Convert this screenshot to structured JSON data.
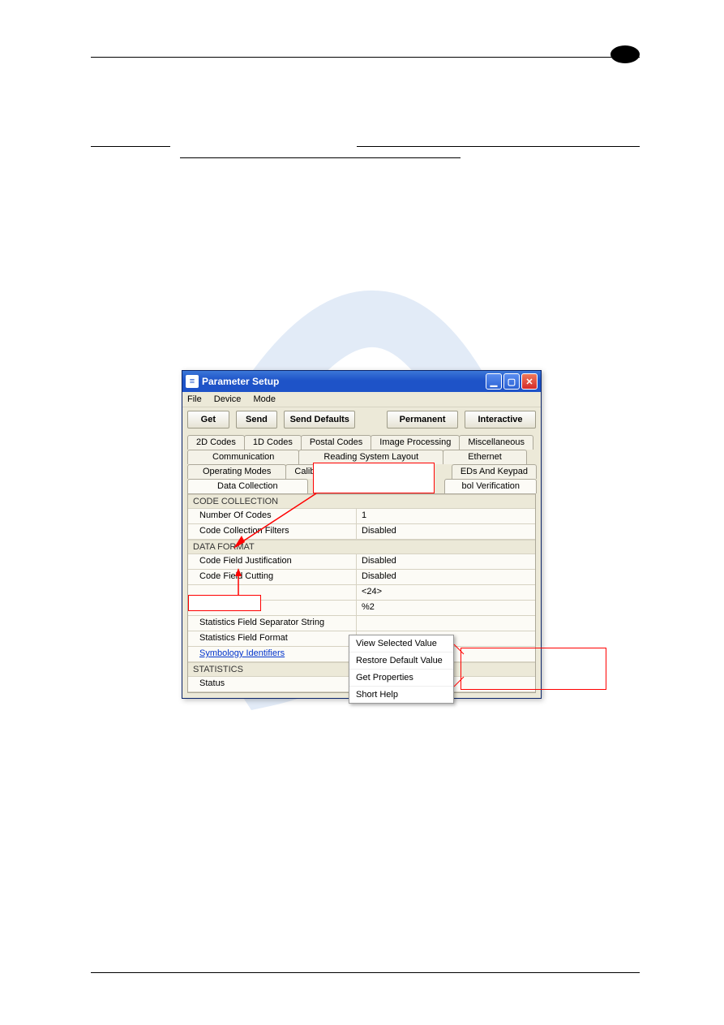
{
  "window": {
    "title": "Parameter Setup",
    "menu": {
      "file": "File",
      "device": "Device",
      "mode": "Mode"
    },
    "toolbar": {
      "get": "Get",
      "send": "Send",
      "send_defaults": "Send Defaults",
      "permanent": "Permanent",
      "interactive": "Interactive"
    },
    "tabs": {
      "row1": [
        "2D Codes",
        "1D Codes",
        "Postal Codes",
        "Image Processing",
        "Miscellaneous"
      ],
      "row2": [
        "Communication",
        "Reading System Layout",
        "Ethernet"
      ],
      "row3_left": "Operating Modes",
      "row3_calibr": "Calibr",
      "row3_right": "EDs And Keypad",
      "row4_left": "Data Collection",
      "row4_right": "bol Verification"
    }
  },
  "sections": {
    "code_collection": {
      "header": "CODE COLLECTION",
      "rows": [
        {
          "label": "Number Of Codes",
          "value": "1"
        },
        {
          "label": "Code Collection Filters",
          "value": "Disabled"
        }
      ]
    },
    "data_format": {
      "header": "DATA FORMAT",
      "rows": [
        {
          "label": "Code Field Justification",
          "value": "Disabled"
        },
        {
          "label": "Code Field Cutting",
          "value": "Disabled"
        },
        {
          "label": "",
          "value": "<24>"
        },
        {
          "label": "",
          "value": "%2"
        },
        {
          "label": "Statistics Field Separator String",
          "value": ""
        },
        {
          "label": "Statistics Field Format",
          "value": ""
        },
        {
          "label": "Symbology Identifiers",
          "value": "",
          "link": true
        }
      ]
    },
    "statistics": {
      "header": "STATISTICS",
      "rows": [
        {
          "label": "Status",
          "value": ""
        }
      ]
    }
  },
  "context_menu": {
    "items": [
      "View Selected Value",
      "Restore Default Value",
      "Get Properties",
      "Short Help"
    ]
  }
}
